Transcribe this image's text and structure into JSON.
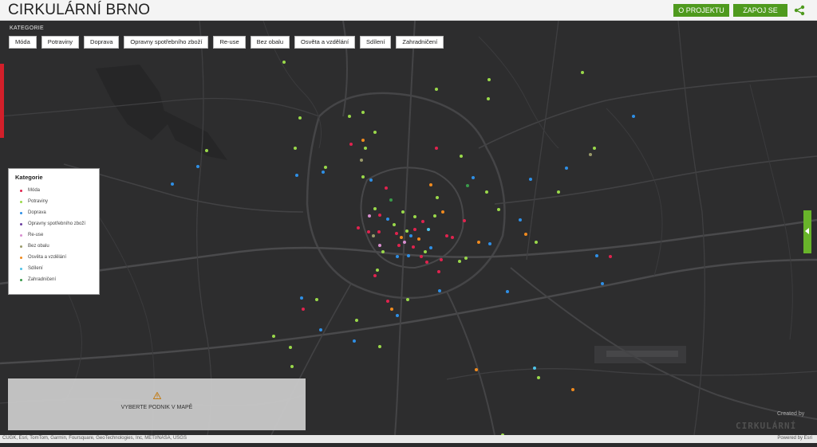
{
  "header": {
    "title": "CIRKULÁRNÍ BRNO",
    "btn_project": "O PROJEKTU",
    "btn_join": "ZAPOJ SE",
    "share_icon": "share-icon"
  },
  "filter": {
    "label": "KATEGORIE",
    "categories": [
      "Móda",
      "Potraviny",
      "Doprava",
      "Opravny spotřebního zboží",
      "Re-use",
      "Bez obalu",
      "Osvěta a vzdělání",
      "Sdílení",
      "Zahradničení"
    ]
  },
  "legend": {
    "title": "Kategorie",
    "items": [
      {
        "label": "Móda",
        "color": "#e0234e"
      },
      {
        "label": "Potraviny",
        "color": "#9ad94a"
      },
      {
        "label": "Doprava",
        "color": "#2e8fe6"
      },
      {
        "label": "Opravny spotřebního zboží",
        "color": "#6b3fa0"
      },
      {
        "label": "Re-use",
        "color": "#d98fd0"
      },
      {
        "label": "Bez obalu",
        "color": "#9a9a6a"
      },
      {
        "label": "Osvěta a vzdělání",
        "color": "#f08a1e"
      },
      {
        "label": "Sdílení",
        "color": "#4fc3e8"
      },
      {
        "label": "Zahradničení",
        "color": "#3a9a4a"
      }
    ]
  },
  "panel": {
    "message": "VYBERTE PODNIK V MAPĚ",
    "icon": "warning-icon"
  },
  "attribution": {
    "left": "CUGK, Esri, TomTom, Garmin, Foursquare, GeoTechnologies, Inc, METI/NASA, USGS",
    "right": "Powered by Esri"
  },
  "credit": {
    "created_by": "Created by",
    "logo_text": "CIRKULÁRNÍ BRNO"
  },
  "colors": {
    "accent": "#4f9a1e",
    "map_bg": "#2d2d2e",
    "road": "#3d3d3f",
    "marker_active": "#d21f2a"
  }
}
